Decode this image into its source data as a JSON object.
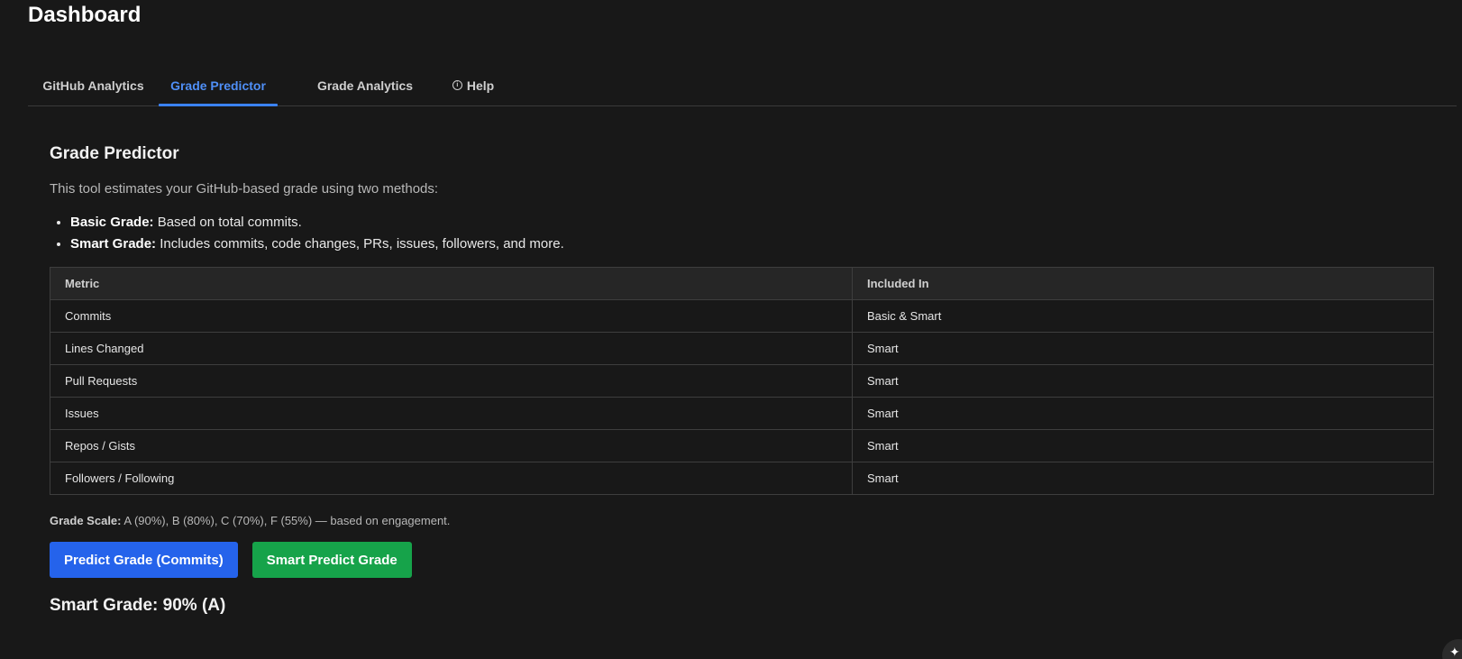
{
  "app": {
    "title": "Dashboard"
  },
  "tabs": [
    {
      "label": "GitHub Analytics",
      "active": false
    },
    {
      "label": "Grade Predictor",
      "active": true
    },
    {
      "label": "Grade Analytics",
      "active": false
    },
    {
      "label": "Help",
      "icon": "info-icon",
      "active": false
    }
  ],
  "predictor": {
    "title": "Grade Predictor",
    "intro": "This tool estimates your GitHub-based grade using two methods:",
    "methods": [
      {
        "name": "Basic Grade:",
        "desc": " Based on total commits."
      },
      {
        "name": "Smart Grade:",
        "desc": " Includes commits, code changes, PRs, issues, followers, and more."
      }
    ],
    "table": {
      "headers": [
        "Metric",
        "Included In"
      ],
      "rows": [
        [
          "Commits",
          "Basic & Smart"
        ],
        [
          "Lines Changed",
          "Smart"
        ],
        [
          "Pull Requests",
          "Smart"
        ],
        [
          "Issues",
          "Smart"
        ],
        [
          "Repos / Gists",
          "Smart"
        ],
        [
          "Followers / Following",
          "Smart"
        ]
      ]
    },
    "scale_label": "Grade Scale:",
    "scale_text": " A (90%), B (80%), C (70%), F (55%) — based on engagement.",
    "buttons": {
      "predict_commits": "Predict Grade (Commits)",
      "smart_predict": "Smart Predict Grade"
    },
    "result": "Smart Grade: 90% (A)"
  },
  "colors": {
    "background": "#181818",
    "accent_blue": "#2563eb",
    "accent_green": "#16a34a",
    "active_tab": "#4f8ff7"
  },
  "icons": {
    "corner": "sparkle-icon"
  }
}
